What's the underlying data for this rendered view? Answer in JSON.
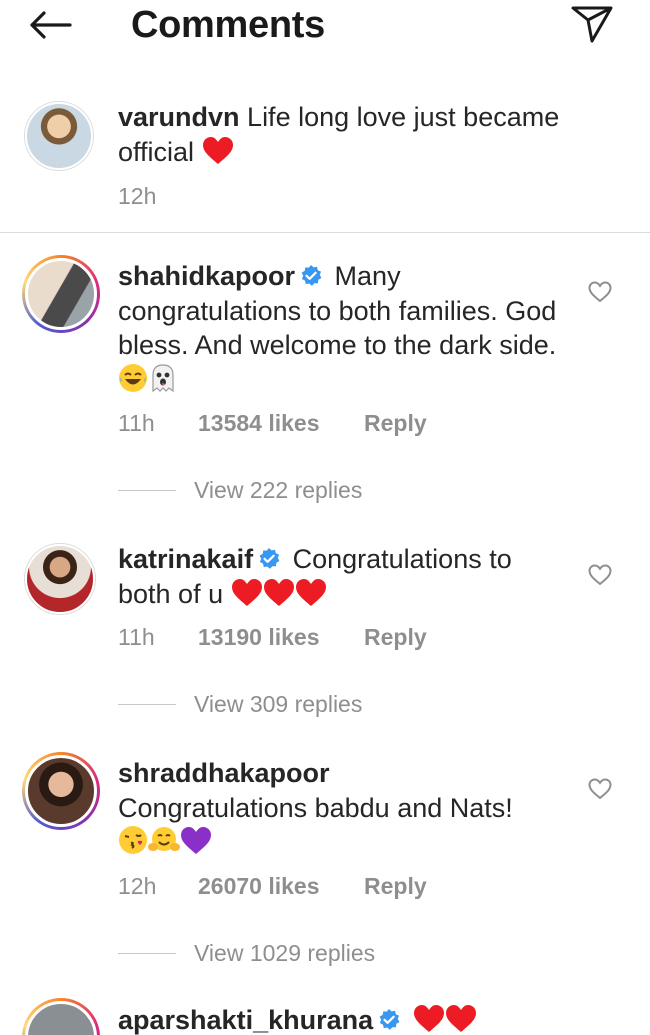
{
  "header": {
    "title": "Comments"
  },
  "caption": {
    "username": "varundvn",
    "text": "Life long love just became official",
    "time": "12h"
  },
  "comments": [
    {
      "username": "shahidkapoor",
      "verified": true,
      "text": "Many congratulations to both families. God bless. And welcome to the dark side.",
      "time": "11h",
      "likes": "13584 likes",
      "reply": "Reply",
      "view_replies": "View 222 replies"
    },
    {
      "username": "katrinakaif",
      "verified": true,
      "text": "Congratulations to both of u",
      "time": "11h",
      "likes": "13190 likes",
      "reply": "Reply",
      "view_replies": "View 309 replies"
    },
    {
      "username": "shraddhakapoor",
      "verified": false,
      "text": "Congratulations babdu and Nats!",
      "time": "12h",
      "likes": "26070 likes",
      "reply": "Reply",
      "view_replies": "View 1029 replies"
    },
    {
      "username": "aparshakti_khurana",
      "verified": true,
      "text": ""
    }
  ],
  "icons": {
    "back": "back-arrow-icon",
    "send": "direct-send-icon",
    "like": "heart-outline-icon",
    "verified": "verified-badge-icon"
  },
  "colors": {
    "text": "#262626",
    "muted": "#8e8e8e",
    "verified": "#3897f0",
    "heart": "#ed1c24",
    "purple_heart": "#8b2fc9"
  }
}
